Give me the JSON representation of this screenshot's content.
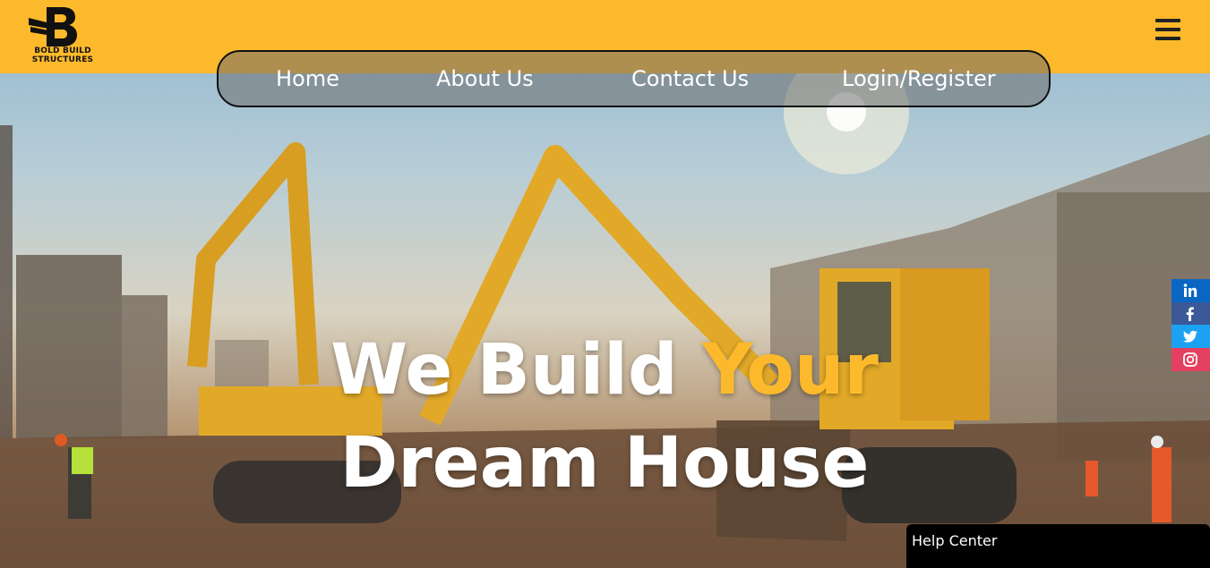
{
  "brand": {
    "logo_line1": "BOLD BUILD",
    "logo_line2": "STRUCTURES",
    "accent_color": "#fdb92c"
  },
  "header": {
    "menu_icon": "hamburger-menu-icon"
  },
  "nav": {
    "items": [
      {
        "label": "Home"
      },
      {
        "label": "About Us"
      },
      {
        "label": "Contact Us"
      },
      {
        "label": "Login/Register"
      }
    ]
  },
  "hero": {
    "line1_part1": "We Build ",
    "line1_accent": "Your",
    "line2": "Dream House"
  },
  "social": [
    {
      "name": "linkedin-icon",
      "color": "#0a66c2"
    },
    {
      "name": "facebook-icon",
      "color": "#3b5998"
    },
    {
      "name": "twitter-icon",
      "color": "#1da1f2"
    },
    {
      "name": "instagram-icon",
      "color": "#e4405f"
    }
  ],
  "help": {
    "label": "Help Center"
  }
}
